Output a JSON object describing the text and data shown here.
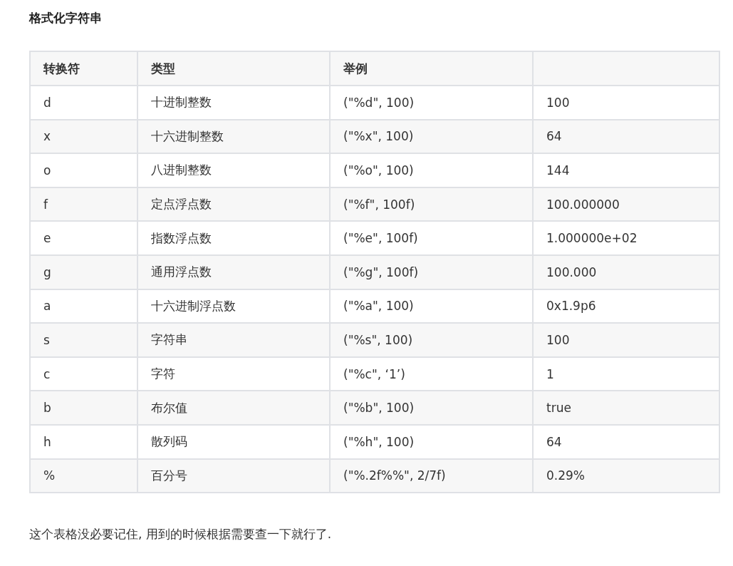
{
  "heading": "格式化字符串",
  "table": {
    "columns": [
      "转换符",
      "类型",
      "举例"
    ],
    "rows": [
      [
        "d",
        "十进制整数",
        "(\"%d\", 100)",
        "100"
      ],
      [
        "x",
        "十六进制整数",
        "(\"%x\", 100)",
        "64"
      ],
      [
        "o",
        "八进制整数",
        "(\"%o\", 100)",
        "144"
      ],
      [
        "f",
        "定点浮点数",
        "(\"%f\", 100f)",
        "100.000000"
      ],
      [
        "e",
        "指数浮点数",
        "(\"%e\", 100f)",
        "1.000000e+02"
      ],
      [
        "g",
        "通用浮点数",
        "(\"%g\", 100f)",
        "100.000"
      ],
      [
        "a",
        "十六进制浮点数",
        "(\"%a\", 100)",
        "0x1.9p6"
      ],
      [
        "s",
        "字符串",
        "(\"%s\", 100)",
        "100"
      ],
      [
        "c",
        "字符",
        "(\"%c\", ‘1’)",
        "1"
      ],
      [
        "b",
        "布尔值",
        "(\"%b\", 100)",
        "true"
      ],
      [
        "h",
        "散列码",
        "(\"%h\", 100)",
        "64"
      ],
      [
        "%",
        "百分号",
        "(\"%.2f%%\", 2/7f)",
        "0.29%"
      ]
    ]
  },
  "note": "这个表格没必要记住, 用到的时候根据需要查一下就行了."
}
